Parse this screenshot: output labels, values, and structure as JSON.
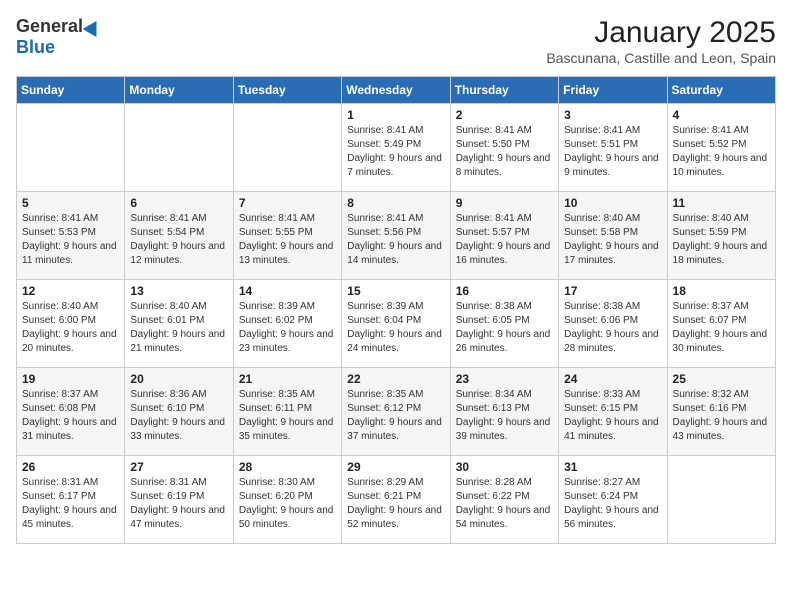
{
  "header": {
    "logo_general": "General",
    "logo_blue": "Blue",
    "month": "January 2025",
    "location": "Bascunana, Castille and Leon, Spain"
  },
  "days_of_week": [
    "Sunday",
    "Monday",
    "Tuesday",
    "Wednesday",
    "Thursday",
    "Friday",
    "Saturday"
  ],
  "weeks": [
    [
      {
        "day": "",
        "info": ""
      },
      {
        "day": "",
        "info": ""
      },
      {
        "day": "",
        "info": ""
      },
      {
        "day": "1",
        "info": "Sunrise: 8:41 AM\nSunset: 5:49 PM\nDaylight: 9 hours and 7 minutes."
      },
      {
        "day": "2",
        "info": "Sunrise: 8:41 AM\nSunset: 5:50 PM\nDaylight: 9 hours and 8 minutes."
      },
      {
        "day": "3",
        "info": "Sunrise: 8:41 AM\nSunset: 5:51 PM\nDaylight: 9 hours and 9 minutes."
      },
      {
        "day": "4",
        "info": "Sunrise: 8:41 AM\nSunset: 5:52 PM\nDaylight: 9 hours and 10 minutes."
      }
    ],
    [
      {
        "day": "5",
        "info": "Sunrise: 8:41 AM\nSunset: 5:53 PM\nDaylight: 9 hours and 11 minutes."
      },
      {
        "day": "6",
        "info": "Sunrise: 8:41 AM\nSunset: 5:54 PM\nDaylight: 9 hours and 12 minutes."
      },
      {
        "day": "7",
        "info": "Sunrise: 8:41 AM\nSunset: 5:55 PM\nDaylight: 9 hours and 13 minutes."
      },
      {
        "day": "8",
        "info": "Sunrise: 8:41 AM\nSunset: 5:56 PM\nDaylight: 9 hours and 14 minutes."
      },
      {
        "day": "9",
        "info": "Sunrise: 8:41 AM\nSunset: 5:57 PM\nDaylight: 9 hours and 16 minutes."
      },
      {
        "day": "10",
        "info": "Sunrise: 8:40 AM\nSunset: 5:58 PM\nDaylight: 9 hours and 17 minutes."
      },
      {
        "day": "11",
        "info": "Sunrise: 8:40 AM\nSunset: 5:59 PM\nDaylight: 9 hours and 18 minutes."
      }
    ],
    [
      {
        "day": "12",
        "info": "Sunrise: 8:40 AM\nSunset: 6:00 PM\nDaylight: 9 hours and 20 minutes."
      },
      {
        "day": "13",
        "info": "Sunrise: 8:40 AM\nSunset: 6:01 PM\nDaylight: 9 hours and 21 minutes."
      },
      {
        "day": "14",
        "info": "Sunrise: 8:39 AM\nSunset: 6:02 PM\nDaylight: 9 hours and 23 minutes."
      },
      {
        "day": "15",
        "info": "Sunrise: 8:39 AM\nSunset: 6:04 PM\nDaylight: 9 hours and 24 minutes."
      },
      {
        "day": "16",
        "info": "Sunrise: 8:38 AM\nSunset: 6:05 PM\nDaylight: 9 hours and 26 minutes."
      },
      {
        "day": "17",
        "info": "Sunrise: 8:38 AM\nSunset: 6:06 PM\nDaylight: 9 hours and 28 minutes."
      },
      {
        "day": "18",
        "info": "Sunrise: 8:37 AM\nSunset: 6:07 PM\nDaylight: 9 hours and 30 minutes."
      }
    ],
    [
      {
        "day": "19",
        "info": "Sunrise: 8:37 AM\nSunset: 6:08 PM\nDaylight: 9 hours and 31 minutes."
      },
      {
        "day": "20",
        "info": "Sunrise: 8:36 AM\nSunset: 6:10 PM\nDaylight: 9 hours and 33 minutes."
      },
      {
        "day": "21",
        "info": "Sunrise: 8:35 AM\nSunset: 6:11 PM\nDaylight: 9 hours and 35 minutes."
      },
      {
        "day": "22",
        "info": "Sunrise: 8:35 AM\nSunset: 6:12 PM\nDaylight: 9 hours and 37 minutes."
      },
      {
        "day": "23",
        "info": "Sunrise: 8:34 AM\nSunset: 6:13 PM\nDaylight: 9 hours and 39 minutes."
      },
      {
        "day": "24",
        "info": "Sunrise: 8:33 AM\nSunset: 6:15 PM\nDaylight: 9 hours and 41 minutes."
      },
      {
        "day": "25",
        "info": "Sunrise: 8:32 AM\nSunset: 6:16 PM\nDaylight: 9 hours and 43 minutes."
      }
    ],
    [
      {
        "day": "26",
        "info": "Sunrise: 8:31 AM\nSunset: 6:17 PM\nDaylight: 9 hours and 45 minutes."
      },
      {
        "day": "27",
        "info": "Sunrise: 8:31 AM\nSunset: 6:19 PM\nDaylight: 9 hours and 47 minutes."
      },
      {
        "day": "28",
        "info": "Sunrise: 8:30 AM\nSunset: 6:20 PM\nDaylight: 9 hours and 50 minutes."
      },
      {
        "day": "29",
        "info": "Sunrise: 8:29 AM\nSunset: 6:21 PM\nDaylight: 9 hours and 52 minutes."
      },
      {
        "day": "30",
        "info": "Sunrise: 8:28 AM\nSunset: 6:22 PM\nDaylight: 9 hours and 54 minutes."
      },
      {
        "day": "31",
        "info": "Sunrise: 8:27 AM\nSunset: 6:24 PM\nDaylight: 9 hours and 56 minutes."
      },
      {
        "day": "",
        "info": ""
      }
    ]
  ]
}
